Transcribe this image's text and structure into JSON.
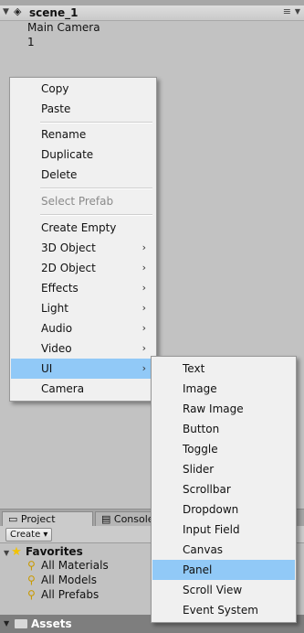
{
  "hierarchy": {
    "scene_title": "scene_1",
    "items": [
      "Main Camera",
      "1"
    ]
  },
  "context_menu": {
    "items": [
      {
        "label": "Copy"
      },
      {
        "label": "Paste"
      },
      {
        "label": "Rename"
      },
      {
        "label": "Duplicate"
      },
      {
        "label": "Delete"
      },
      {
        "label": "Select Prefab",
        "disabled": true
      },
      {
        "label": "Create Empty"
      },
      {
        "label": "3D Object",
        "submenu": true
      },
      {
        "label": "2D Object",
        "submenu": true
      },
      {
        "label": "Effects",
        "submenu": true
      },
      {
        "label": "Light",
        "submenu": true
      },
      {
        "label": "Audio",
        "submenu": true
      },
      {
        "label": "Video",
        "submenu": true
      },
      {
        "label": "UI",
        "submenu": true,
        "highlighted": true
      },
      {
        "label": "Camera"
      }
    ],
    "highlight_color": "#91c9f7"
  },
  "ui_submenu": {
    "items": [
      {
        "label": "Text"
      },
      {
        "label": "Image"
      },
      {
        "label": "Raw Image"
      },
      {
        "label": "Button"
      },
      {
        "label": "Toggle"
      },
      {
        "label": "Slider"
      },
      {
        "label": "Scrollbar"
      },
      {
        "label": "Dropdown"
      },
      {
        "label": "Input Field"
      },
      {
        "label": "Canvas"
      },
      {
        "label": "Panel",
        "highlighted": true
      },
      {
        "label": "Scroll View"
      },
      {
        "label": "Event System"
      }
    ]
  },
  "project": {
    "tabs": [
      "Project",
      "Console"
    ],
    "create_label": "Create",
    "favorites_label": "Favorites",
    "favorites": [
      "All Materials",
      "All Models",
      "All Prefabs"
    ],
    "assets_label": "Assets"
  }
}
